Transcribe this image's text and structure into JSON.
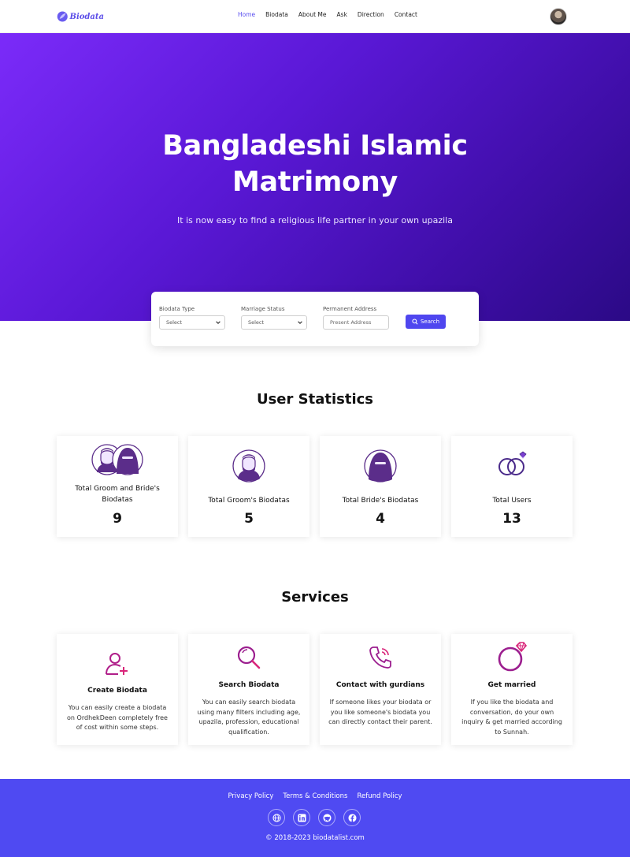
{
  "nav": {
    "logo_text": "Biodata",
    "items": [
      {
        "label": "Home",
        "active": true
      },
      {
        "label": "Biodata"
      },
      {
        "label": "About Me"
      },
      {
        "label": "Ask"
      },
      {
        "label": "Direction"
      },
      {
        "label": "Contact"
      }
    ],
    "accent": "#5a4ff0"
  },
  "hero": {
    "title_line1": "Bangladeshi Islamic",
    "title_line2": "Matrimony",
    "subtitle": "It is now easy to find a religious life partner in your own upazila",
    "gradient_from": "#7b2bf9",
    "gradient_to": "#2b0a86"
  },
  "search": {
    "biodata_type": {
      "label": "Biodata Type",
      "value": "Select"
    },
    "marriage_status": {
      "label": "Marriage Status",
      "value": "Select"
    },
    "address": {
      "label": "Permanent Address",
      "placeholder": "Present Address"
    },
    "button_label": "Search",
    "button_color": "#4f46ef"
  },
  "stats": {
    "title": "User Statistics",
    "cards": [
      {
        "icon": "couple-icon",
        "label": "Total Groom and Bride's Biodatas",
        "value": "9"
      },
      {
        "icon": "groom-icon",
        "label": "Total Groom's Biodatas",
        "value": "5"
      },
      {
        "icon": "bride-icon",
        "label": "Total Bride's Biodatas",
        "value": "4"
      },
      {
        "icon": "rings-icon",
        "label": "Total Users",
        "value": "13"
      }
    ]
  },
  "services": {
    "title": "Services",
    "cards": [
      {
        "icon": "add-user-icon",
        "title": "Create Biodata",
        "desc": "You can easily create a biodata on OrdhekDeen completely free of cost within some steps."
      },
      {
        "icon": "magnifier-icon",
        "title": "Search Biodata",
        "desc": "You can easily search biodata using many filters including age, upazila, profession, educational qualification."
      },
      {
        "icon": "phone-icon",
        "title": "Contact with gurdians",
        "desc": "If someone likes your biodata or you like someone's biodata you can directly contact their parent."
      },
      {
        "icon": "ring-icon",
        "title": "Get married",
        "desc": "If you like the biodata and conversation, do your own inquiry & get married according to Sunnah."
      }
    ]
  },
  "footer": {
    "links": [
      "Privacy Policy",
      "Terms & Conditions",
      "Refund Policy"
    ],
    "socials": [
      "globe-icon",
      "linkedin-icon",
      "github-icon",
      "facebook-icon"
    ],
    "copyright": "© 2018-2023 biodatalist.com",
    "background": "#4f4af2"
  }
}
